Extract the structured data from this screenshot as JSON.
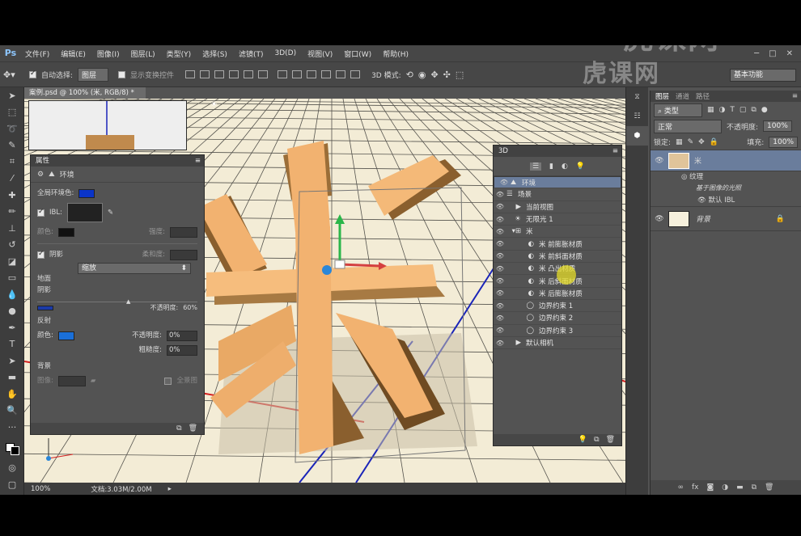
{
  "watermark": "虎课网",
  "menu": {
    "logo": "Ps",
    "items": [
      "文件(F)",
      "编辑(E)",
      "图像(I)",
      "图层(L)",
      "类型(Y)",
      "选择(S)",
      "滤镜(T)",
      "3D(D)",
      "视图(V)",
      "窗口(W)",
      "帮助(H)"
    ]
  },
  "options": {
    "auto_select_label": "自动选择:",
    "auto_select_value": "图层",
    "show_transform": "显示变换控件",
    "mode_3d": "3D 模式:",
    "workspace": "基本功能"
  },
  "document": {
    "tab_title": "案例.psd @ 100% (米, RGB/8) *",
    "zoom": "100%",
    "doc_info": "文档:3.03M/2.00M"
  },
  "properties": {
    "tab": "属性",
    "section": "环境",
    "global_ambient_label": "全局环境色:",
    "global_ambient_color": "#0a34c8",
    "ibl_label": "IBL:",
    "color_label": "颜色:",
    "color_value": "#111111",
    "intensity_label": "强度:",
    "shadow_label": "阴影",
    "softness_label": "柔和度:",
    "zoom_select": "缩放",
    "ground_label": "地面",
    "ground_shadow_label": "阴影",
    "ground_opacity_label": "不透明度:",
    "ground_opacity_value": "60%",
    "reflection_label": "反射",
    "reflection_color_label": "颜色:",
    "reflection_color": "#1a6fd8",
    "reflection_opacity_label": "不透明度:",
    "reflection_opacity_value": "0%",
    "roughness_label": "粗糙度:",
    "roughness_value": "0%",
    "background_label": "背景",
    "image_label": "图像:",
    "panorama_label": "全景图"
  },
  "panel3d": {
    "tab": "3D",
    "rows": [
      {
        "label": "环境",
        "indent": 0,
        "selected": true
      },
      {
        "label": "场景",
        "indent": 0,
        "selected": false
      },
      {
        "label": "当前视图",
        "indent": 1,
        "selected": false
      },
      {
        "label": "无限光 1",
        "indent": 1,
        "selected": false
      },
      {
        "label": "米",
        "indent": 1,
        "selected": false
      },
      {
        "label": "米 前膨胀材质",
        "indent": 2,
        "selected": false
      },
      {
        "label": "米 前斜面材质",
        "indent": 2,
        "selected": false
      },
      {
        "label": "米 凸出材质",
        "indent": 2,
        "selected": false
      },
      {
        "label": "米 后斜面材质",
        "indent": 2,
        "selected": false
      },
      {
        "label": "米 后膨胀材质",
        "indent": 2,
        "selected": false
      },
      {
        "label": "边界约束 1",
        "indent": 2,
        "selected": false
      },
      {
        "label": "边界约束 2",
        "indent": 2,
        "selected": false
      },
      {
        "label": "边界约束 3",
        "indent": 2,
        "selected": false
      },
      {
        "label": "默认相机",
        "indent": 1,
        "selected": false
      }
    ]
  },
  "layers_panel": {
    "tabs": [
      "图层",
      "通道",
      "路径"
    ],
    "filter": "类型",
    "blend_mode": "正常",
    "opacity_label": "不透明度:",
    "opacity_value": "100%",
    "lock_label": "锁定:",
    "fill_label": "填充:",
    "fill_value": "100%",
    "layers": [
      {
        "name": "米",
        "sub": [
          "纹理",
          "基于图像的光照",
          "默认 IBL"
        ]
      },
      {
        "name": "背景"
      }
    ]
  },
  "colors": {
    "letter_front": "#f2b270",
    "letter_side": "#9b6e38",
    "ground": "#f3ecd6",
    "grid": "#1e1e1e",
    "axis_red": "#d42020",
    "axis_blue": "#1a24b8"
  }
}
